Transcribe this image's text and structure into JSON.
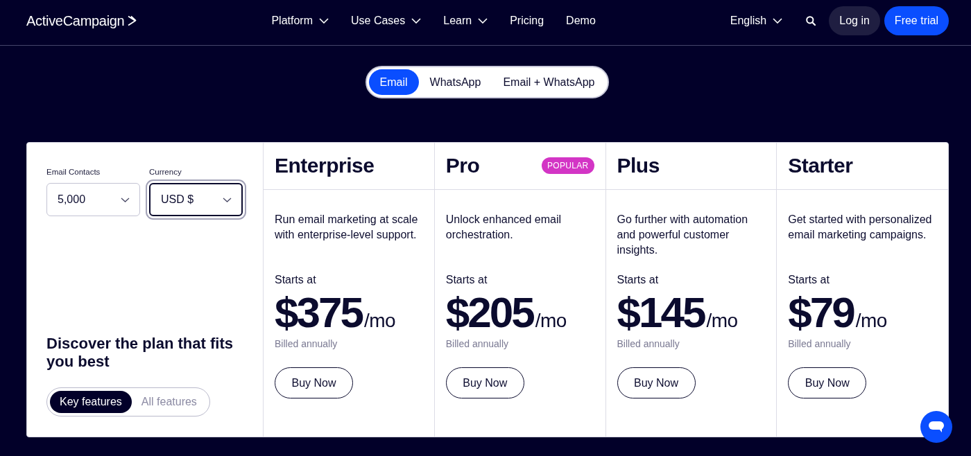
{
  "header": {
    "logo": "ActiveCampaign",
    "nav": [
      {
        "label": "Platform",
        "kind": "menu"
      },
      {
        "label": "Use Cases",
        "kind": "menu"
      },
      {
        "label": "Learn",
        "kind": "menu"
      },
      {
        "label": "Pricing",
        "kind": "link"
      },
      {
        "label": "Demo",
        "kind": "link"
      }
    ],
    "language": "English",
    "buttons": [
      {
        "label": "Log in",
        "kind": "secondary"
      },
      {
        "label": "Free trial",
        "kind": "primary"
      }
    ]
  },
  "channel_tabs": [
    {
      "label": "Email",
      "selected": true
    },
    {
      "label": "WhatsApp",
      "selected": false
    },
    {
      "label": "Email + WhatsApp",
      "selected": false
    }
  ],
  "filters": [
    {
      "label": "Email Contacts",
      "value": "5,000",
      "focused": false
    },
    {
      "label": "Currency",
      "value": "USD $",
      "focused": true
    }
  ],
  "intro": {
    "heading": "Discover the plan that fits you best",
    "view_tabs": [
      {
        "label": "Key features",
        "selected": true
      },
      {
        "label": "All features",
        "selected": false
      }
    ]
  },
  "plans": [
    {
      "name": "Enterprise",
      "description": "Run email marketing at scale with enterprise-level support.",
      "price_prefix": "Starts at",
      "price": "$375",
      "period": "/mo",
      "billing": "Billed annually",
      "button": "Buy Now"
    },
    {
      "name": "Pro",
      "badge": "POPULAR",
      "description": "Unlock enhanced email orchestration.",
      "price_prefix": "Starts at",
      "price": "$205",
      "period": "/mo",
      "billing": "Billed annually",
      "button": "Buy Now"
    },
    {
      "name": "Plus",
      "description": "Go further with automation and powerful customer insights.",
      "price_prefix": "Starts at",
      "price": "$145",
      "period": "/mo",
      "billing": "Billed annually",
      "button": "Buy Now"
    },
    {
      "name": "Starter",
      "description": "Get started with personalized email marketing campaigns.",
      "price_prefix": "Starts at",
      "price": "$79",
      "period": "/mo",
      "billing": "Billed annually",
      "button": "Buy Now"
    }
  ]
}
